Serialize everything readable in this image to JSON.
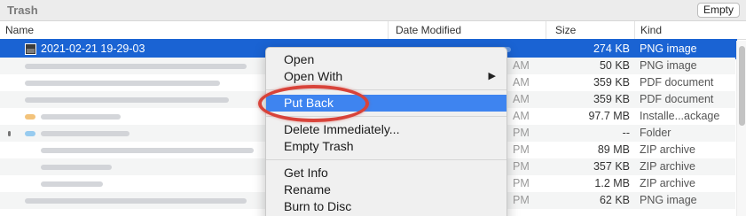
{
  "window": {
    "title": "Trash",
    "empty_button": "Empty"
  },
  "columns": {
    "name": "Name",
    "date": "Date Modified",
    "size": "Size",
    "kind": "Kind"
  },
  "rows": [
    {
      "name": "2021-02-21 19-29-03",
      "date_visible": "",
      "size": "274 KB",
      "kind": "PNG image",
      "selected": true
    },
    {
      "name": "",
      "date_visible": "AM",
      "size": "50 KB",
      "kind": "PNG image"
    },
    {
      "name": "",
      "date_visible": "AM",
      "size": "359 KB",
      "kind": "PDF document"
    },
    {
      "name": "",
      "date_visible": "AM",
      "size": "359 KB",
      "kind": "PDF document"
    },
    {
      "name": "",
      "date_visible": "AM",
      "size": "97.7 MB",
      "kind": "Installe...ackage"
    },
    {
      "name": "",
      "date_visible": "PM",
      "size": "--",
      "kind": "Folder"
    },
    {
      "name": "",
      "date_visible": "PM",
      "size": "89 MB",
      "kind": "ZIP archive"
    },
    {
      "name": "",
      "date_visible": "PM",
      "size": "357 KB",
      "kind": "ZIP archive"
    },
    {
      "name": "",
      "date_visible": "PM",
      "size": "1.2 MB",
      "kind": "ZIP archive"
    },
    {
      "name": "",
      "date_visible": "PM",
      "size": "62 KB",
      "kind": "PNG image"
    }
  ],
  "context_menu": {
    "open": "Open",
    "open_with": "Open With",
    "open_with_arrow": "▶",
    "put_back": "Put Back",
    "delete_immediately": "Delete Immediately...",
    "empty_trash": "Empty Trash",
    "get_info": "Get Info",
    "rename": "Rename",
    "burn_to_disc": "Burn to Disc"
  },
  "colors": {
    "selection": "#1a63d3",
    "menu_highlight": "#3e84f0",
    "annotation": "#d8433a"
  }
}
